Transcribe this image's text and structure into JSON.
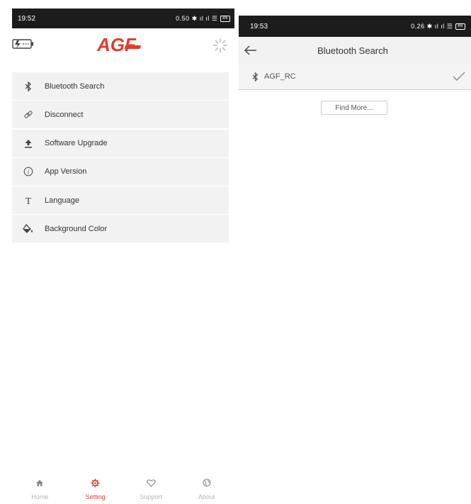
{
  "left_screen": {
    "status_bar": {
      "time": "19:52",
      "icons_text": "0.50 ✱ ıl ıl ☰",
      "battery": "86"
    },
    "header": {
      "logo_text": "AGF",
      "battery_icon": "battery-charging-icon",
      "spinner_icon": "loading-spinner-icon"
    },
    "menu": {
      "items": [
        {
          "label": "Bluetooth Search",
          "icon": "bluetooth-icon"
        },
        {
          "label": "Disconnect",
          "icon": "link-icon"
        },
        {
          "label": "Software Upgrade",
          "icon": "upload-icon"
        },
        {
          "label": "App Version",
          "icon": "info-icon"
        },
        {
          "label": "Language",
          "icon": "text-icon"
        },
        {
          "label": "Background Color",
          "icon": "paint-bucket-icon"
        }
      ]
    },
    "bottom_nav": {
      "items": [
        {
          "label": "Home",
          "icon": "home-icon",
          "active": false
        },
        {
          "label": "Setting",
          "icon": "gear-icon",
          "active": true
        },
        {
          "label": "Support",
          "icon": "heart-icon",
          "active": false
        },
        {
          "label": "About",
          "icon": "globe-icon",
          "active": false
        }
      ]
    }
  },
  "right_screen": {
    "status_bar": {
      "time": "19:53",
      "icons_text": "0.26 ✱ ıl ıl ☰",
      "battery": "86"
    },
    "top_bar": {
      "title": "Bluetooth Search",
      "back_icon": "arrow-left-icon"
    },
    "device_list": [
      {
        "name": "AGF_RC",
        "icon": "bluetooth-icon",
        "connected": true
      }
    ],
    "find_more_label": "Find More..."
  },
  "colors": {
    "accent": "#e23b2e",
    "status_bar": "#1c1c1c",
    "menu_bg": "#f2f2f2",
    "inactive_nav": "#b5b5b5"
  }
}
